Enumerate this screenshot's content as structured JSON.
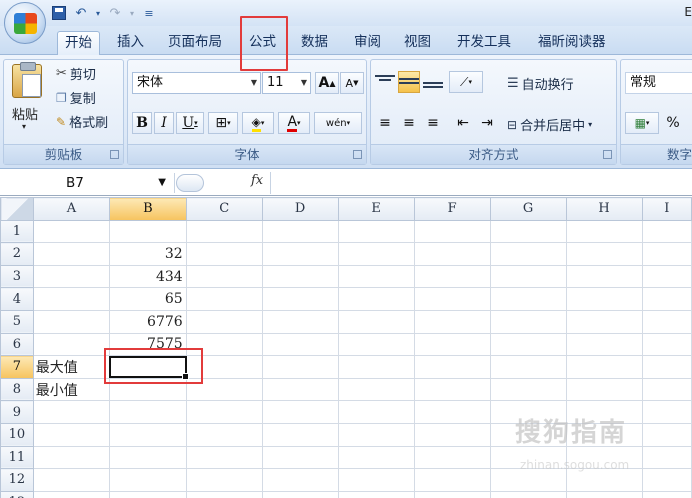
{
  "titlebar": {
    "right_text": "E",
    "qat_icons": [
      "save-icon",
      "undo-icon",
      "redo-icon",
      "customize-qat-icon"
    ]
  },
  "tabs": [
    {
      "label": "开始",
      "active": true
    },
    {
      "label": "插入"
    },
    {
      "label": "页面布局"
    },
    {
      "label": "公式"
    },
    {
      "label": "数据"
    },
    {
      "label": "审阅"
    },
    {
      "label": "视图"
    },
    {
      "label": "开发工具"
    },
    {
      "label": "福昕阅读器"
    }
  ],
  "clipboard": {
    "paste_label": "粘贴",
    "cut_label": "剪切",
    "copy_label": "复制",
    "format_painter_label": "格式刷",
    "group_label": "剪贴板"
  },
  "font": {
    "font_name": "宋体",
    "font_size": "11",
    "bold": "B",
    "italic": "I",
    "underline": "U",
    "grow": "A",
    "shrink": "A",
    "font_color_label": "A",
    "phonetic_label": "wén",
    "group_label": "字体"
  },
  "alignment": {
    "wrap_text_label": "自动换行",
    "merge_center_label": "合并后居中",
    "group_label": "对齐方式"
  },
  "number": {
    "format_value": "常规",
    "percent_label": "%",
    "group_label": "数字"
  },
  "formula_bar": {
    "name_box": "B7",
    "fx_label": "fx",
    "content": ""
  },
  "sheet": {
    "columns": [
      "A",
      "B",
      "C",
      "D",
      "E",
      "F",
      "G",
      "H",
      "I"
    ],
    "selected_column": "B",
    "selected_row": "7",
    "rows": [
      {
        "n": "1",
        "a": "",
        "b": ""
      },
      {
        "n": "2",
        "a": "",
        "b": "32"
      },
      {
        "n": "3",
        "a": "",
        "b": "434"
      },
      {
        "n": "4",
        "a": "",
        "b": "65"
      },
      {
        "n": "5",
        "a": "",
        "b": "6776"
      },
      {
        "n": "6",
        "a": "",
        "b": "7575"
      },
      {
        "n": "7",
        "a": "最大值",
        "b": ""
      },
      {
        "n": "8",
        "a": "最小值",
        "b": ""
      },
      {
        "n": "9",
        "a": "",
        "b": ""
      },
      {
        "n": "10",
        "a": "",
        "b": ""
      },
      {
        "n": "11",
        "a": "",
        "b": ""
      },
      {
        "n": "12",
        "a": "",
        "b": ""
      },
      {
        "n": "13",
        "a": "",
        "b": ""
      }
    ]
  },
  "watermark": {
    "text": "搜狗指南",
    "subtext": "zhinan.sogou.com"
  },
  "colors": {
    "highlight": "#e23b3b",
    "selection_header": "#f6c35e",
    "ribbon_bg": "#dce8f7"
  }
}
